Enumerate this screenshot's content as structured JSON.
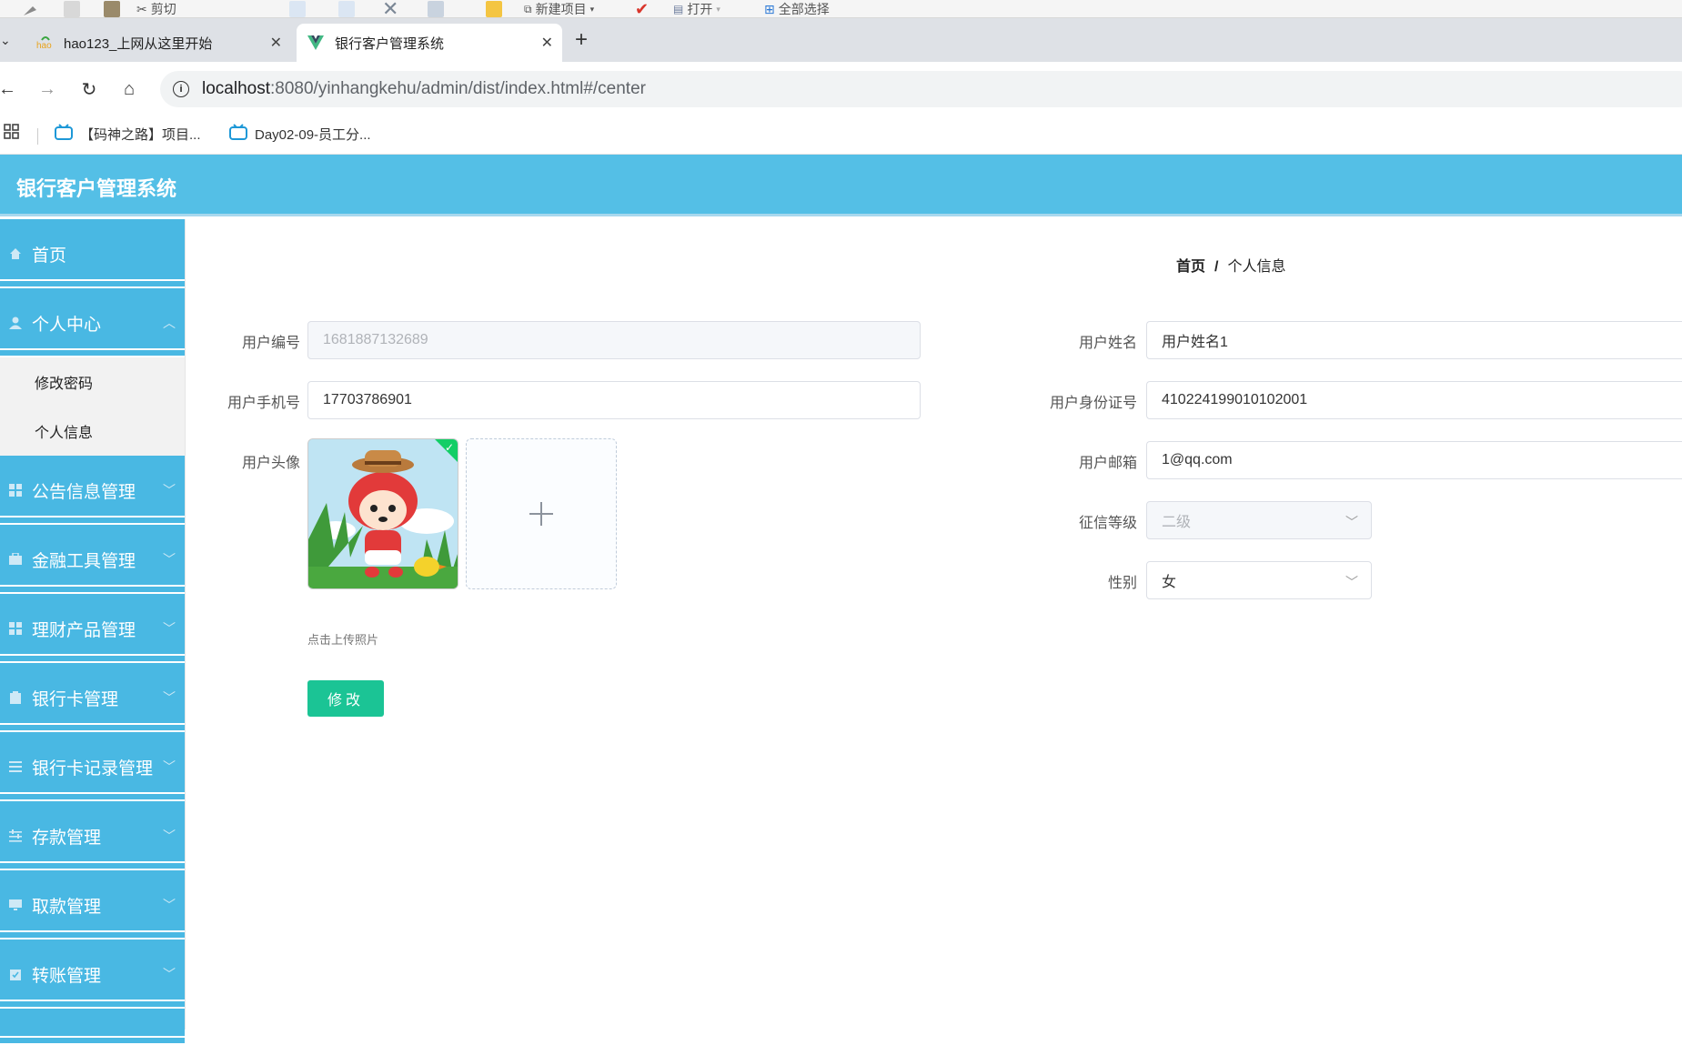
{
  "explorer": {
    "cut_label": "剪切",
    "new_item_label": "新建项目",
    "open_label": "打开",
    "select_all_label": "全部选择"
  },
  "browser": {
    "tabs": [
      {
        "title": "hao123_上网从这里开始",
        "active": false
      },
      {
        "title": "银行客户管理系统",
        "active": true
      }
    ],
    "url_host": "localhost",
    "url_rest": ":8080/yinhangkehu/admin/dist/index.html#/center",
    "bookmarks": [
      "【码神之路】项目...",
      "Day02-09-员工分..."
    ]
  },
  "app": {
    "title": "银行客户管理系统",
    "accent": "#54bfe6",
    "sidebar_color": "#49b8e3",
    "button_color": "#1bc495"
  },
  "sidebar": {
    "items": [
      {
        "label": "首页",
        "icon": "home-icon"
      },
      {
        "label": "个人中心",
        "icon": "user-icon",
        "expanded": true,
        "children": [
          "修改密码",
          "个人信息"
        ]
      },
      {
        "label": "公告信息管理",
        "icon": "grid-icon"
      },
      {
        "label": "金融工具管理",
        "icon": "briefcase-icon"
      },
      {
        "label": "理财产品管理",
        "icon": "grid-icon"
      },
      {
        "label": "银行卡管理",
        "icon": "clipboard-icon"
      },
      {
        "label": "银行卡记录管理",
        "icon": "list-icon"
      },
      {
        "label": "存款管理",
        "icon": "sliders-icon"
      },
      {
        "label": "取款管理",
        "icon": "monitor-icon"
      },
      {
        "label": "转账管理",
        "icon": "clipboard-check-icon"
      }
    ]
  },
  "breadcrumb": {
    "home": "首页",
    "separator": "/",
    "current": "个人信息"
  },
  "form": {
    "user_no_label": "用户编号",
    "user_no_value": "1681887132689",
    "phone_label": "用户手机号",
    "phone_value": "17703786901",
    "avatar_label": "用户头像",
    "upload_hint": "点击上传照片",
    "name_label": "用户姓名",
    "name_value": "用户姓名1",
    "idcard_label": "用户身份证号",
    "idcard_value": "410224199010102001",
    "email_label": "用户邮箱",
    "email_value": "1@qq.com",
    "credit_label": "征信等级",
    "credit_value": "二级",
    "gender_label": "性别",
    "gender_value": "女",
    "submit_label": "修改"
  }
}
